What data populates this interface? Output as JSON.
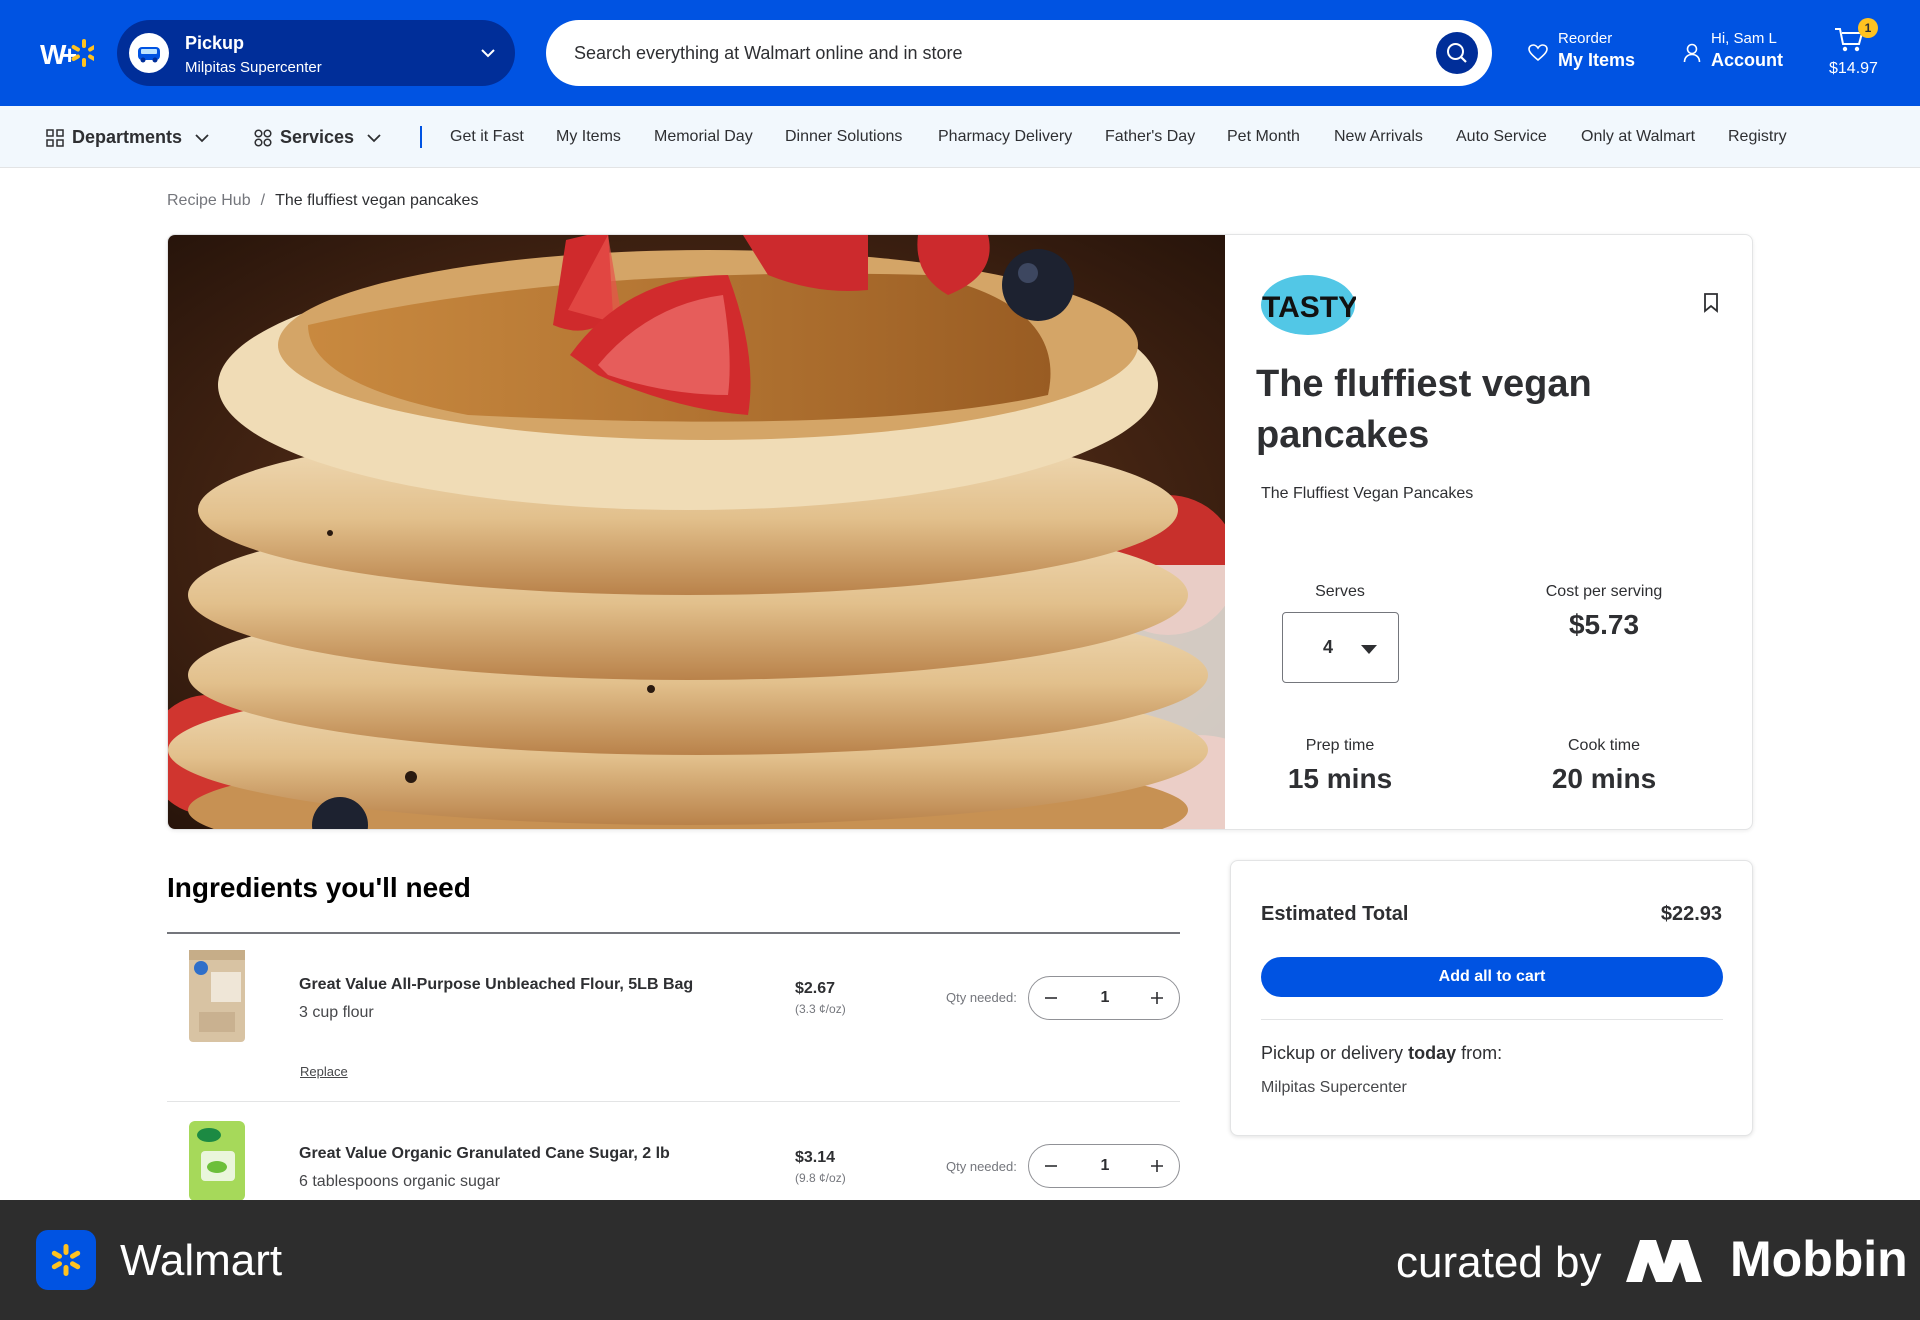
{
  "header": {
    "pickup": {
      "title": "Pickup",
      "store": "Milpitas Supercenter"
    },
    "search": {
      "placeholder": "Search everything at Walmart online and in store"
    },
    "reorder": {
      "line1": "Reorder",
      "line2": "My Items"
    },
    "account": {
      "line1": "Hi, Sam L",
      "line2": "Account"
    },
    "cart": {
      "count": "1",
      "total": "$14.97"
    },
    "accent_color": "#0053e2",
    "spark_color": "#ffc220"
  },
  "subnav": {
    "departments": "Departments",
    "services": "Services",
    "links": [
      "Get it Fast",
      "My Items",
      "Memorial Day",
      "Dinner Solutions",
      "Pharmacy Delivery",
      "Father's Day",
      "Pet Month",
      "New Arrivals",
      "Auto Service",
      "Only at Walmart",
      "Registry"
    ]
  },
  "breadcrumb": {
    "parent": "Recipe Hub",
    "current": "The fluffiest vegan pancakes"
  },
  "recipe": {
    "brand": "TASTY",
    "title": "The fluffiest vegan pancakes",
    "subtitle": "The Fluffiest Vegan Pancakes",
    "serves_label": "Serves",
    "serves_value": "4",
    "cost_label": "Cost per serving",
    "cost_value": "$5.73",
    "prep_label": "Prep time",
    "prep_value": "15 mins",
    "cook_label": "Cook time",
    "cook_value": "20 mins"
  },
  "ingredients": {
    "heading": "Ingredients you'll need",
    "qty_label": "Qty needed:",
    "replace_label": "Replace",
    "items": [
      {
        "name": "Great Value All-Purpose Unbleached Flour, 5LB Bag",
        "note": "3 cup flour",
        "price": "$2.67",
        "unit_price": "(3.3 ¢/oz)",
        "qty": "1"
      },
      {
        "name": "Great Value Organic Granulated Cane Sugar, 2 lb",
        "note": "6 tablespoons organic sugar",
        "price": "$3.14",
        "unit_price": "(9.8 ¢/oz)",
        "qty": "1"
      }
    ]
  },
  "estimate": {
    "label": "Estimated Total",
    "total": "$22.93",
    "button": "Add all to cart",
    "pickup_prefix": "Pickup or delivery",
    "pickup_bold": "today",
    "pickup_suffix": "from:",
    "store": "Milpitas Supercenter"
  },
  "footer": {
    "app": "Walmart",
    "curated": "curated by",
    "brand": "Mobbin"
  }
}
